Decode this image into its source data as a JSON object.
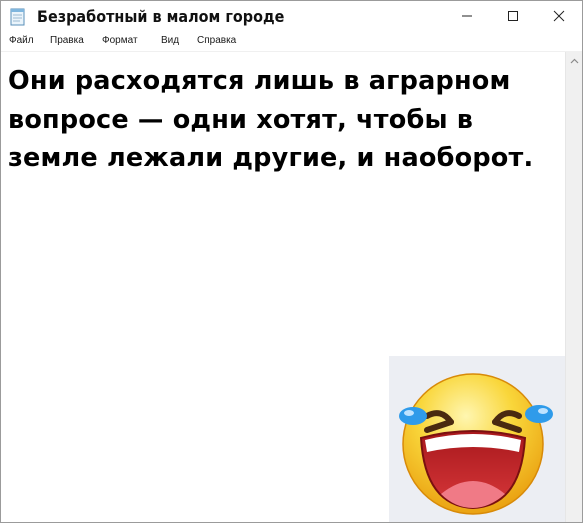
{
  "window": {
    "title": "Безработный в малом городе",
    "icons": {
      "app": "notepad-icon",
      "minimize": "minimize-icon",
      "maximize": "maximize-icon",
      "close": "close-icon"
    }
  },
  "menu": {
    "items": [
      {
        "label": "Файл"
      },
      {
        "label": "Правка"
      },
      {
        "label": "Формат"
      },
      {
        "label": "Вид"
      },
      {
        "label": "Справка"
      }
    ]
  },
  "document": {
    "lines": [
      "Они расходятся лишь в аграрном",
      "вопросе — одни хотят, чтобы в",
      "земле лежали другие, и наоборот."
    ]
  },
  "scrollbar": {
    "arrow_icon": "chevron-up-icon"
  },
  "sticker": {
    "emoji": "laughing-crying-emoji"
  },
  "colors": {
    "emoji_yellow": "#f8c81e",
    "tears_blue": "#2f9bea",
    "mouth_red": "#c8292c",
    "sticker_bg": "#eceef3"
  }
}
